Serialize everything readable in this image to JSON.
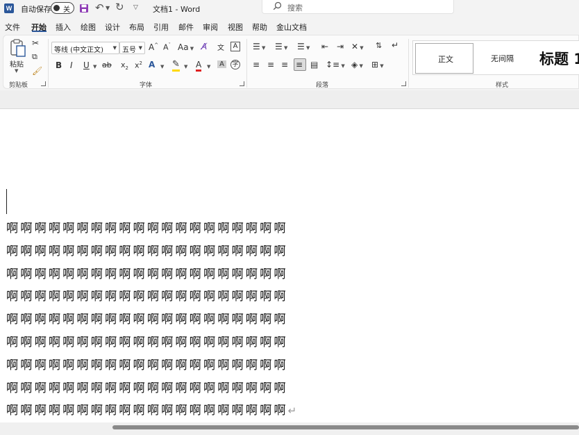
{
  "titlebar": {
    "app_logo": "W",
    "autosave_label": "自动保存",
    "autosave_state": "关",
    "icons": [
      "word-logo-icon",
      "save-icon",
      "undo-icon",
      "redo-icon",
      "customize-qat-icon",
      "search-icon"
    ],
    "doc_title": "文档1 - Word",
    "search_placeholder": "搜索"
  },
  "tabs": [
    "文件",
    "开始",
    "插入",
    "绘图",
    "设计",
    "布局",
    "引用",
    "邮件",
    "审阅",
    "视图",
    "帮助",
    "金山文档"
  ],
  "active_tab": "开始",
  "ribbon": {
    "clipboard": {
      "paste_label": "粘贴",
      "group_label": "剪贴板"
    },
    "font": {
      "font_name": "等线 (中文正文)",
      "font_size": "五号",
      "grow": "A",
      "shrink": "A",
      "case": "Aa",
      "bold": "B",
      "italic": "I",
      "underline": "U",
      "strike": "ab",
      "subscript": "x",
      "superscript": "x",
      "text_effect": "A",
      "font_color": "A",
      "char_shading": "A",
      "enclose": "字",
      "group_label": "字体"
    },
    "paragraph": {
      "group_label": "段落"
    },
    "styles": {
      "normal": "正文",
      "no_spacing": "无间隔",
      "heading1": "标题 1",
      "group_label": "样式"
    }
  },
  "colors": {
    "accent": "#2b579a",
    "highlight": "#ffd800",
    "font_color": "#e02020"
  },
  "document": {
    "lines": [
      "啊啊啊啊啊啊啊啊啊啊啊啊啊啊啊啊啊啊啊啊",
      "啊啊啊啊啊啊啊啊啊啊啊啊啊啊啊啊啊啊啊啊",
      "啊啊啊啊啊啊啊啊啊啊啊啊啊啊啊啊啊啊啊啊",
      "啊啊啊啊啊啊啊啊啊啊啊啊啊啊啊啊啊啊啊啊",
      "啊啊啊啊啊啊啊啊啊啊啊啊啊啊啊啊啊啊啊啊",
      "啊啊啊啊啊啊啊啊啊啊啊啊啊啊啊啊啊啊啊啊",
      "啊啊啊啊啊啊啊啊啊啊啊啊啊啊啊啊啊啊啊啊",
      "啊啊啊啊啊啊啊啊啊啊啊啊啊啊啊啊啊啊啊啊",
      "啊啊啊啊啊啊啊啊啊啊啊啊啊啊啊啊啊啊啊啊"
    ],
    "paragraph_mark": "↵"
  }
}
